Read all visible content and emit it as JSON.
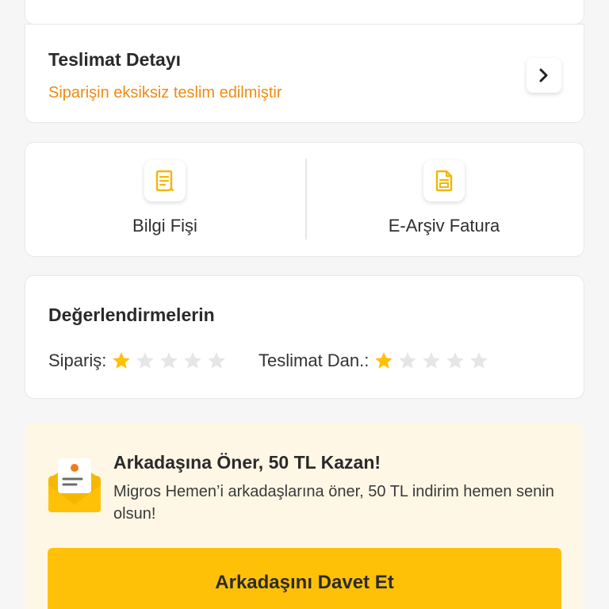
{
  "delivery": {
    "title": "Teslimat Detayı",
    "status": "Siparişin eksiksiz teslim edilmiştir",
    "chevron_icon": "chevron-right-icon"
  },
  "documents": {
    "items": [
      {
        "label": "Bilgi Fişi",
        "icon": "receipt-icon"
      },
      {
        "label": "E-Arşiv Fatura",
        "icon": "invoice-document-icon"
      }
    ]
  },
  "ratings": {
    "title": "Değerlendirmelerin",
    "order": {
      "label": "Sipariş:",
      "value": 1,
      "max": 5
    },
    "delivery_person": {
      "label": "Teslimat Dan.:",
      "value": 1,
      "max": 5
    }
  },
  "referral": {
    "title": "Arkadaşına Öner, 50 TL Kazan!",
    "description": "Migros Hemen’i arkadaşlarına öner, 50 TL indirim hemen senin olsun!",
    "button_label": "Arkadaşını Davet Et",
    "icon": "invite-envelope-icon"
  },
  "colors": {
    "accent": "#ffc107",
    "status_orange": "#ef8a12",
    "star_filled": "#ffc107",
    "star_empty": "#e6e6e6",
    "referral_bg": "#fff7e6"
  }
}
